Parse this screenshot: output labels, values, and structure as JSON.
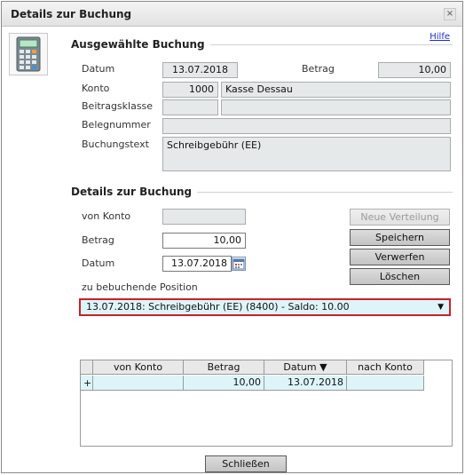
{
  "window": {
    "title": "Details zur Buchung",
    "close_label": "×"
  },
  "help": {
    "label": "Hilfe"
  },
  "selected": {
    "section_title": "Ausgewählte Buchung",
    "datum_label": "Datum",
    "datum_value": "13.07.2018",
    "betrag_label": "Betrag",
    "betrag_value": "10,00",
    "konto_label": "Konto",
    "konto_number": "1000",
    "konto_name": "Kasse Dessau",
    "beitragsklasse_label": "Beitragsklasse",
    "beitragsklasse_value": "",
    "beitragsklasse_desc": "",
    "belegnummer_label": "Belegnummer",
    "belegnummer_value": "",
    "buchungstext_label": "Buchungstext",
    "buchungstext_value": "Schreibgebühr (EE)"
  },
  "details": {
    "section_title": "Details zur Buchung",
    "von_konto_label": "von Konto",
    "von_konto_value": "",
    "betrag_label": "Betrag",
    "betrag_value": "10,00",
    "datum_label": "Datum",
    "datum_value": "13.07.2018",
    "position_label": "zu bebuchende Position",
    "position_value": "13.07.2018: Schreibgebühr (EE) (8400) - Saldo: 10.00",
    "position_arrow": "▼",
    "buttons": {
      "neue_verteilung": "Neue Verteilung",
      "speichern": "Speichern",
      "verwerfen": "Verwerfen",
      "loeschen": "Löschen"
    }
  },
  "grid": {
    "columns": [
      "von Konto",
      "Betrag",
      "Datum ▼",
      "nach Konto"
    ],
    "rows": [
      {
        "marker": "+",
        "von_konto": "",
        "betrag": "10,00",
        "datum": "13.07.2018",
        "nach_konto": ""
      }
    ]
  },
  "footer": {
    "close_button": "Schließen"
  },
  "colors": {
    "highlight_row": "#ddf5f9",
    "select_border": "#c8202a",
    "link": "#1a2ed0"
  },
  "icons": {
    "app_icon": "calculator-icon",
    "calendar": "calendar-icon",
    "close": "close-icon",
    "dropdown": "chevron-down-icon"
  }
}
